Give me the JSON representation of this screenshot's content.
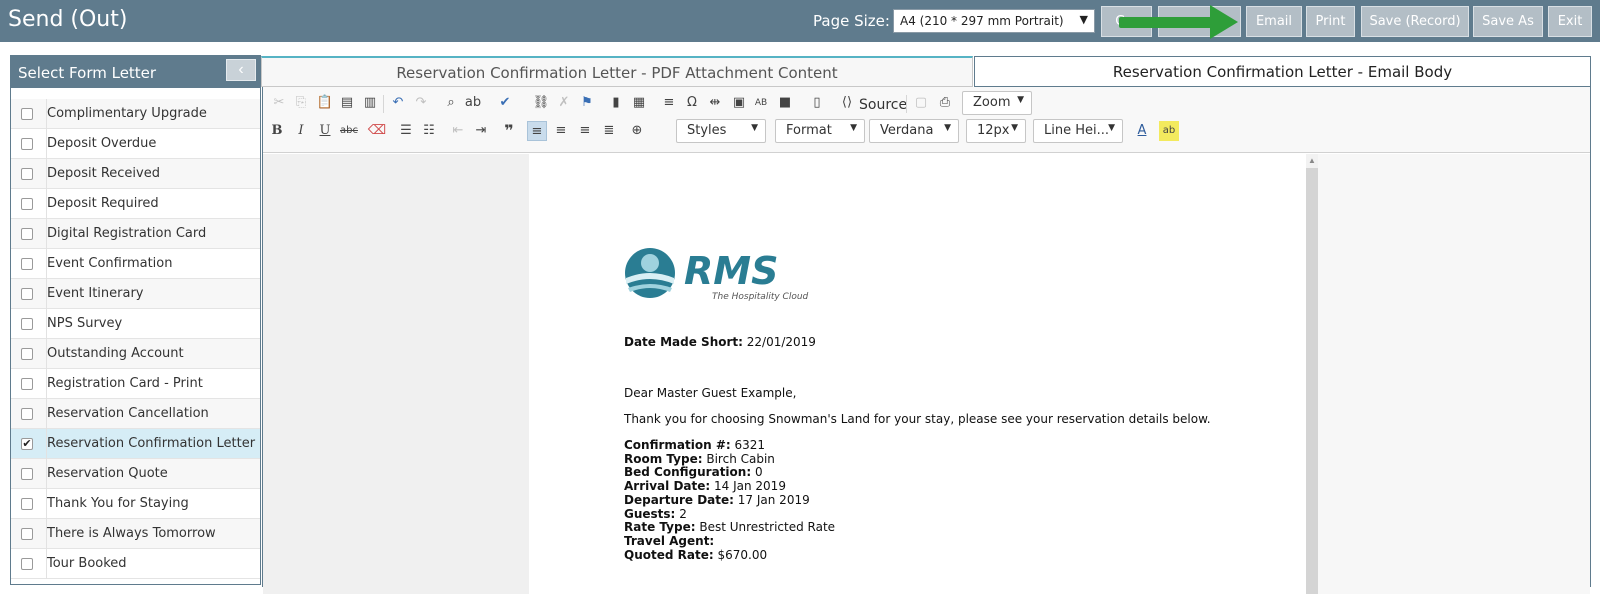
{
  "header": {
    "title": "Send (Out)",
    "page_size_label": "Page Size:",
    "page_size_value": "A4 (210 * 297 mm Portrait)",
    "buttons": [
      "G...",
      "...",
      "Email",
      "Print",
      "Save (Record)",
      "Save As",
      "Exit"
    ]
  },
  "left_panel": {
    "title": "Select Form Letter",
    "collapse_icon": "chevron-left-icon",
    "items": [
      {
        "label": "Complimentary Upgrade",
        "checked": false
      },
      {
        "label": "Deposit Overdue",
        "checked": false
      },
      {
        "label": "Deposit Received",
        "checked": false
      },
      {
        "label": "Deposit Required",
        "checked": false
      },
      {
        "label": "Digital Registration Card",
        "checked": false
      },
      {
        "label": "Event Confirmation",
        "checked": false
      },
      {
        "label": "Event Itinerary",
        "checked": false
      },
      {
        "label": "NPS Survey",
        "checked": false
      },
      {
        "label": "Outstanding Account",
        "checked": false
      },
      {
        "label": "Registration Card - Print",
        "checked": false
      },
      {
        "label": "Reservation Cancellation",
        "checked": false
      },
      {
        "label": "Reservation Confirmation Letter",
        "checked": true
      },
      {
        "label": "Reservation Quote",
        "checked": false
      },
      {
        "label": "Thank You for Staying",
        "checked": false
      },
      {
        "label": "There is Always Tomorrow",
        "checked": false
      },
      {
        "label": "Tour Booked",
        "checked": false
      }
    ]
  },
  "tabs": [
    {
      "label": "Reservation Confirmation Letter - PDF Attachment Content",
      "active": true
    },
    {
      "label": "Reservation Confirmation Letter - Email Body",
      "active": false
    }
  ],
  "toolbar": {
    "source_label": "Source",
    "zoom_label": "Zoom",
    "styles_label": "Styles",
    "format_label": "Format",
    "font_label": "Verdana",
    "size_label": "12px",
    "line_height_label": "Line Hei..."
  },
  "document": {
    "logo_text": "RMS",
    "logo_tagline": "The Hospitality Cloud",
    "date_label": "Date Made Short:",
    "date_value": "22/01/2019",
    "greeting": "Dear Master Guest Example,",
    "intro": "Thank you for choosing Snowman's Land for your stay, please see your reservation details below.",
    "details": [
      {
        "label": "Confirmation #:",
        "value": "6321"
      },
      {
        "label": "Room Type:",
        "value": "Birch Cabin"
      },
      {
        "label": "Bed Configuration:",
        "value": "0"
      },
      {
        "label": "Arrival Date:",
        "value": "14 Jan 2019"
      },
      {
        "label": "Departure Date:",
        "value": "17 Jan 2019"
      },
      {
        "label": "Guests:",
        "value": "2"
      },
      {
        "label": "Rate Type:",
        "value": "Best Unrestricted Rate"
      },
      {
        "label": "Travel Agent:",
        "value": ""
      },
      {
        "label": "Quoted Rate:",
        "value": "$670.00"
      }
    ]
  },
  "colors": {
    "header_bg": "#5f7b8d",
    "button_bg": "#b3bec6",
    "selected_row": "#d6edf6",
    "arrow": "#2e9e39",
    "logo_teal": "#2a7d93"
  }
}
